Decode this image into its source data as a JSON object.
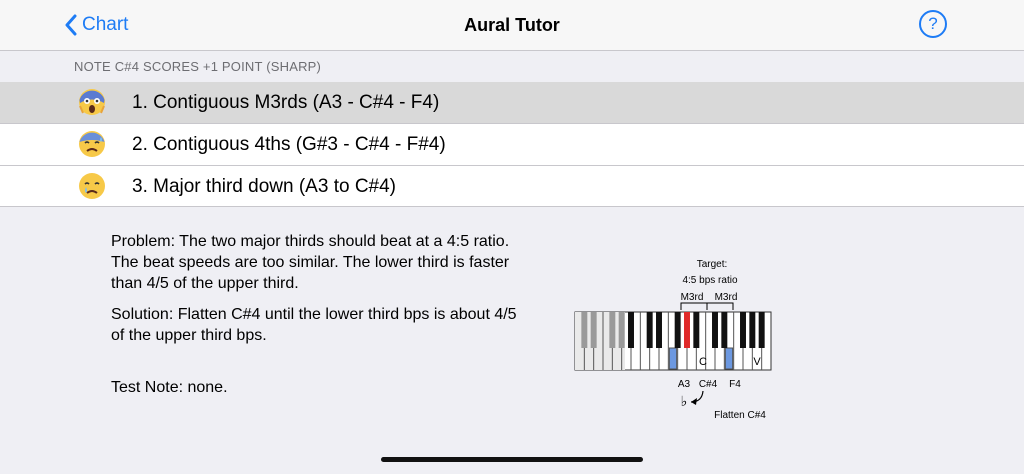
{
  "nav": {
    "back_label": "Chart",
    "title": "Aural Tutor",
    "help_label": "?"
  },
  "section": {
    "header": "NOTE C#4 SCORES +1 POINT (SHARP)"
  },
  "items": [
    {
      "label": "1. Contiguous M3rds (A3 - C#4 - F4)",
      "icon": "screaming-face-icon",
      "selected": true
    },
    {
      "label": "2. Contiguous 4ths (G#3 - C#4 - F#4)",
      "icon": "anxious-sweat-face-icon",
      "selected": false
    },
    {
      "label": "3. Major third down (A3 to C#4)",
      "icon": "crying-face-icon",
      "selected": false
    }
  ],
  "detail": {
    "problem": "Problem: The two major thirds should beat at a 4:5 ratio. The beat speeds are too similar. The lower third is faster than 4/5 of the upper third.",
    "solution": "Solution: Flatten C#4 until the lower third bps is about 4/5 of the upper third bps.",
    "test_note": "Test Note: none."
  },
  "diagram": {
    "target_line1": "Target:",
    "target_line2": "4:5 bps ratio",
    "interval1": "M3rd",
    "interval2": "M3rd",
    "note1": "A3",
    "note2": "C#4",
    "note3": "F4",
    "key_mark_c": "C",
    "key_mark_v": "V",
    "flat_symbol": "♭",
    "flatten_label": "Flatten C#4",
    "colors": {
      "highlight": "#6c98e0",
      "target": "#e02a2a"
    }
  }
}
